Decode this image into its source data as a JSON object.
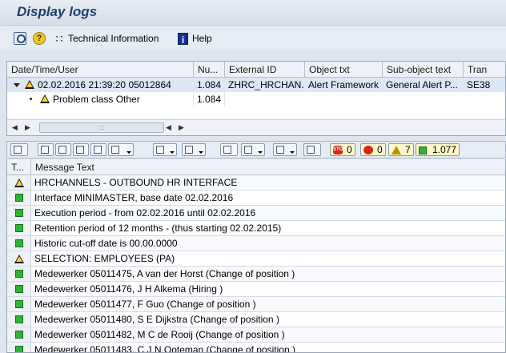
{
  "title": "Display logs",
  "toolbar": {
    "technical_info_label": "Technical Information",
    "help_label": "Help"
  },
  "tree": {
    "columns": [
      "Date/Time/User",
      "Nu...",
      "External ID",
      "Object txt",
      "Sub-object text",
      "Tran"
    ],
    "rows": [
      {
        "date_time_user": "02.02.2016  21:39:20  05012864",
        "number": "1.084",
        "external_id": "ZHRC_HRCHAN...",
        "object_txt": "Alert Framework",
        "sub_object_text": "General Alert P...",
        "tran": "SE38"
      },
      {
        "date_time_user": "Problem class Other",
        "number": "1.084",
        "external_id": "",
        "object_txt": "",
        "sub_object_text": "",
        "tran": ""
      }
    ],
    "scroll_thumb": ":::"
  },
  "alv_toolbar": {
    "counts": {
      "stop": "0",
      "error": "0",
      "warning": "7",
      "success": "1.077"
    },
    "stop_icon_text": "STOP"
  },
  "messages": {
    "columns": [
      "T...",
      "Message Text"
    ],
    "rows": [
      {
        "type": "warning",
        "text": "HRCHANNELS - OUTBOUND HR INTERFACE"
      },
      {
        "type": "success",
        "text": "Interface MINIMASTER, base date 02.02.2016"
      },
      {
        "type": "success",
        "text": "Execution period - from 02.02.2016 until 02.02.2016"
      },
      {
        "type": "success",
        "text": "Retention period of 12 months - (thus starting 02.02.2015)"
      },
      {
        "type": "success",
        "text": "Historic cut-off date is 00.00.0000"
      },
      {
        "type": "warning",
        "text": "SELECTION: EMPLOYEES (PA)"
      },
      {
        "type": "success",
        "text": "Medewerker 05011475, A van der Horst (Change of position )"
      },
      {
        "type": "success",
        "text": "Medewerker 05011476, J H Alkema (Hiring )"
      },
      {
        "type": "success",
        "text": "Medewerker 05011477, F Guo (Change of position )"
      },
      {
        "type": "success",
        "text": "Medewerker 05011480, S E Dijkstra (Change of position )"
      },
      {
        "type": "success",
        "text": "Medewerker 05011482, M C de Rooij (Change of position )"
      },
      {
        "type": "success",
        "text": "Medewerker 05011483, C J N Ooteman (Change of position )"
      }
    ]
  }
}
